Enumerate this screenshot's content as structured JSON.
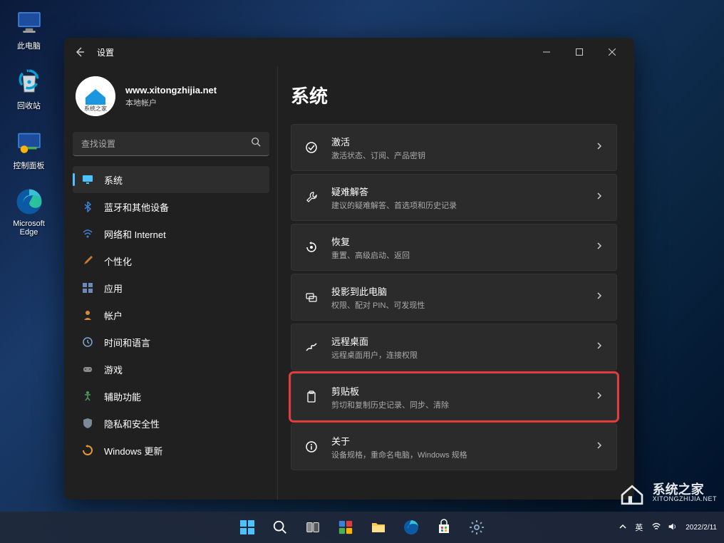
{
  "desktop_icons": [
    {
      "id": "this-pc",
      "label": "此电脑"
    },
    {
      "id": "recycle-bin",
      "label": "回收站"
    },
    {
      "id": "control-panel",
      "label": "控制面板"
    },
    {
      "id": "edge",
      "label": "Microsoft Edge"
    }
  ],
  "window": {
    "title": "设置",
    "profile": {
      "name": "www.xitongzhijia.net",
      "subtitle": "本地帐户"
    },
    "search_placeholder": "查找设置",
    "nav": [
      {
        "id": "system",
        "label": "系统",
        "active": true,
        "icon": "display"
      },
      {
        "id": "bluetooth",
        "label": "蓝牙和其他设备",
        "icon": "bluetooth"
      },
      {
        "id": "network",
        "label": "网络和 Internet",
        "icon": "wifi"
      },
      {
        "id": "personalization",
        "label": "个性化",
        "icon": "brush"
      },
      {
        "id": "apps",
        "label": "应用",
        "icon": "apps"
      },
      {
        "id": "accounts",
        "label": "帐户",
        "icon": "person"
      },
      {
        "id": "time-language",
        "label": "时间和语言",
        "icon": "clock"
      },
      {
        "id": "gaming",
        "label": "游戏",
        "icon": "game"
      },
      {
        "id": "accessibility",
        "label": "辅助功能",
        "icon": "accessibility"
      },
      {
        "id": "privacy",
        "label": "隐私和安全性",
        "icon": "shield"
      },
      {
        "id": "windows-update",
        "label": "Windows 更新",
        "icon": "update"
      }
    ],
    "content": {
      "title": "系统",
      "cards": [
        {
          "id": "activation",
          "title": "激活",
          "subtitle": "激活状态、订阅、产品密钥",
          "icon": "check",
          "highlighted": false
        },
        {
          "id": "troubleshoot",
          "title": "疑难解答",
          "subtitle": "建议的疑难解答、首选项和历史记录",
          "icon": "wrench",
          "highlighted": false
        },
        {
          "id": "recovery",
          "title": "恢复",
          "subtitle": "重置、高级启动、返回",
          "icon": "recovery",
          "highlighted": false
        },
        {
          "id": "projecting",
          "title": "投影到此电脑",
          "subtitle": "权限、配对 PIN、可发现性",
          "icon": "project",
          "highlighted": false
        },
        {
          "id": "remote-desktop",
          "title": "远程桌面",
          "subtitle": "远程桌面用户，连接权限",
          "icon": "remote",
          "highlighted": false
        },
        {
          "id": "clipboard",
          "title": "剪贴板",
          "subtitle": "剪切和复制历史记录、同步、清除",
          "icon": "clipboard",
          "highlighted": true
        },
        {
          "id": "about",
          "title": "关于",
          "subtitle": "设备规格，重命名电脑，Windows 规格",
          "icon": "info",
          "highlighted": false
        }
      ]
    }
  },
  "taskbar": {
    "tray": {
      "ime": "英",
      "date": "2022/2/11"
    }
  },
  "watermark": {
    "brand": "系统之家",
    "url": "XITONGZHIJIA.NET"
  }
}
